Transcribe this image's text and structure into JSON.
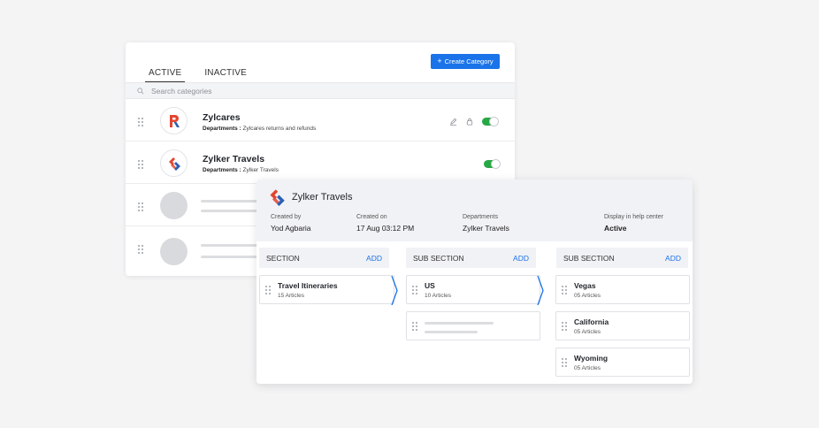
{
  "categories_panel": {
    "tabs": [
      {
        "label": "ACTIVE",
        "active": true
      },
      {
        "label": "INACTIVE",
        "active": false
      }
    ],
    "create_button": "Create Category",
    "search": {
      "placeholder": "Search categories"
    },
    "rows": [
      {
        "name": "Zylcares",
        "dept_label": "Departments :",
        "dept_value": "Zylcares returns and refunds",
        "enabled": true
      },
      {
        "name": "Zylker Travels",
        "dept_label": "Departments :",
        "dept_value": "Zylker Travels",
        "enabled": true
      }
    ]
  },
  "detail_panel": {
    "title": "Zylker Travels",
    "meta": [
      {
        "label": "Created by",
        "value": "Yod Agbaria"
      },
      {
        "label": "Created on",
        "value": "17 Aug 03:12 PM"
      },
      {
        "label": "Departments",
        "value": "Zylker Travels"
      },
      {
        "label": "Display in help center",
        "value": "Active"
      }
    ],
    "columns": [
      {
        "header": "SECTION",
        "add_label": "ADD",
        "cards": [
          {
            "title": "Travel Itineraries",
            "subtitle": "15 Articles"
          }
        ]
      },
      {
        "header": "SUB SECTION",
        "add_label": "ADD",
        "cards": [
          {
            "title": "US",
            "subtitle": "10 Articles"
          }
        ]
      },
      {
        "header": "SUB SECTION",
        "add_label": "ADD",
        "cards": [
          {
            "title": "Vegas",
            "subtitle": "05 Articles"
          },
          {
            "title": "California",
            "subtitle": "05 Articles"
          },
          {
            "title": "Wyoming",
            "subtitle": "05 Articles"
          }
        ]
      }
    ]
  },
  "icons": {
    "search": "search-icon",
    "drag": "drag-handle-icon",
    "edit": "edit-icon",
    "lock": "lock-icon",
    "chevron": "chevron-right-icon"
  },
  "colors": {
    "accent": "#1a73e8",
    "toggle_on": "#27a844",
    "logo_red": "#e3452f",
    "logo_blue": "#2c5fb5"
  }
}
